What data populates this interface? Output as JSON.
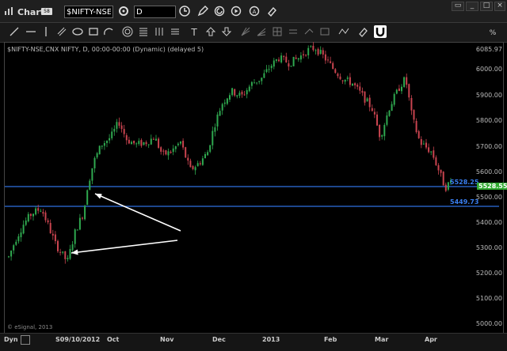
{
  "window": {
    "title": "Chart",
    "badge": "58"
  },
  "header": {
    "symbol_value": "$NIFTY-NSE",
    "interval_value": "D"
  },
  "chart": {
    "description_line": "$NIFTY-NSE,CNX NIFTY, D, 00:00-00:00 (Dynamic) (delayed 5)",
    "copyright": "© eSignal, 2013",
    "y_ticks": [
      "6085.97",
      "6000.00",
      "5900.00",
      "5800.00",
      "5700.00",
      "5600.00",
      "5500.00",
      "5400.00",
      "5300.00",
      "5200.00",
      "5100.00",
      "5000.00"
    ],
    "x_ticks": [
      "S09/10/2012",
      "Oct",
      "Nov",
      "Dec",
      "2013",
      "Feb",
      "Mar",
      "Apr"
    ],
    "last_price": "5528.55",
    "line_1_label": "5528.25",
    "line_2_label": "5449.73",
    "colors": {
      "up": "#2fa84f",
      "down": "#c9444f",
      "hline": "#2f6fe0",
      "last_bg": "#2faa2f"
    }
  },
  "status": {
    "dyn": "Dyn"
  },
  "icons": [
    "chart-icon",
    "settings-icon",
    "clock-icon",
    "pencil-icon",
    "refresh-icon",
    "play-icon",
    "target-icon",
    "eraser-icon",
    "magnet-icon"
  ]
}
